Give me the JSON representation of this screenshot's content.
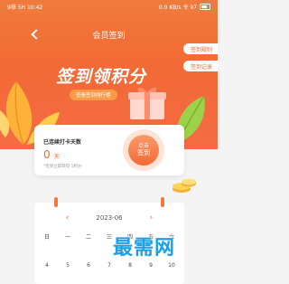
{
  "status": {
    "left": "9移 5H 10:42",
    "right": "0.0 KB/s 令 97"
  },
  "nav": {
    "title": "会员签到"
  },
  "side_buttons": {
    "rules": "签到规则",
    "records": "签到记录"
  },
  "banner": {
    "title": "签到领积分",
    "rank_button": "查看签到排行榜"
  },
  "streak": {
    "label": "已连续打卡天数",
    "value": "0",
    "unit": "天",
    "hint": "*签到立即获得 1积分"
  },
  "sign": {
    "line1": "点击",
    "line2": "签到"
  },
  "calendar": {
    "month": "2023-06",
    "weekdays": [
      "日",
      "一",
      "二",
      "三",
      "四",
      "五",
      "六"
    ],
    "days": [
      "4",
      "5",
      "6",
      "7",
      "8",
      "9",
      "10"
    ]
  },
  "watermark": "最需网",
  "colors": {
    "accent": "#f06a35",
    "header_top": "#f07a3c",
    "watermark": "#1aa0e8"
  }
}
